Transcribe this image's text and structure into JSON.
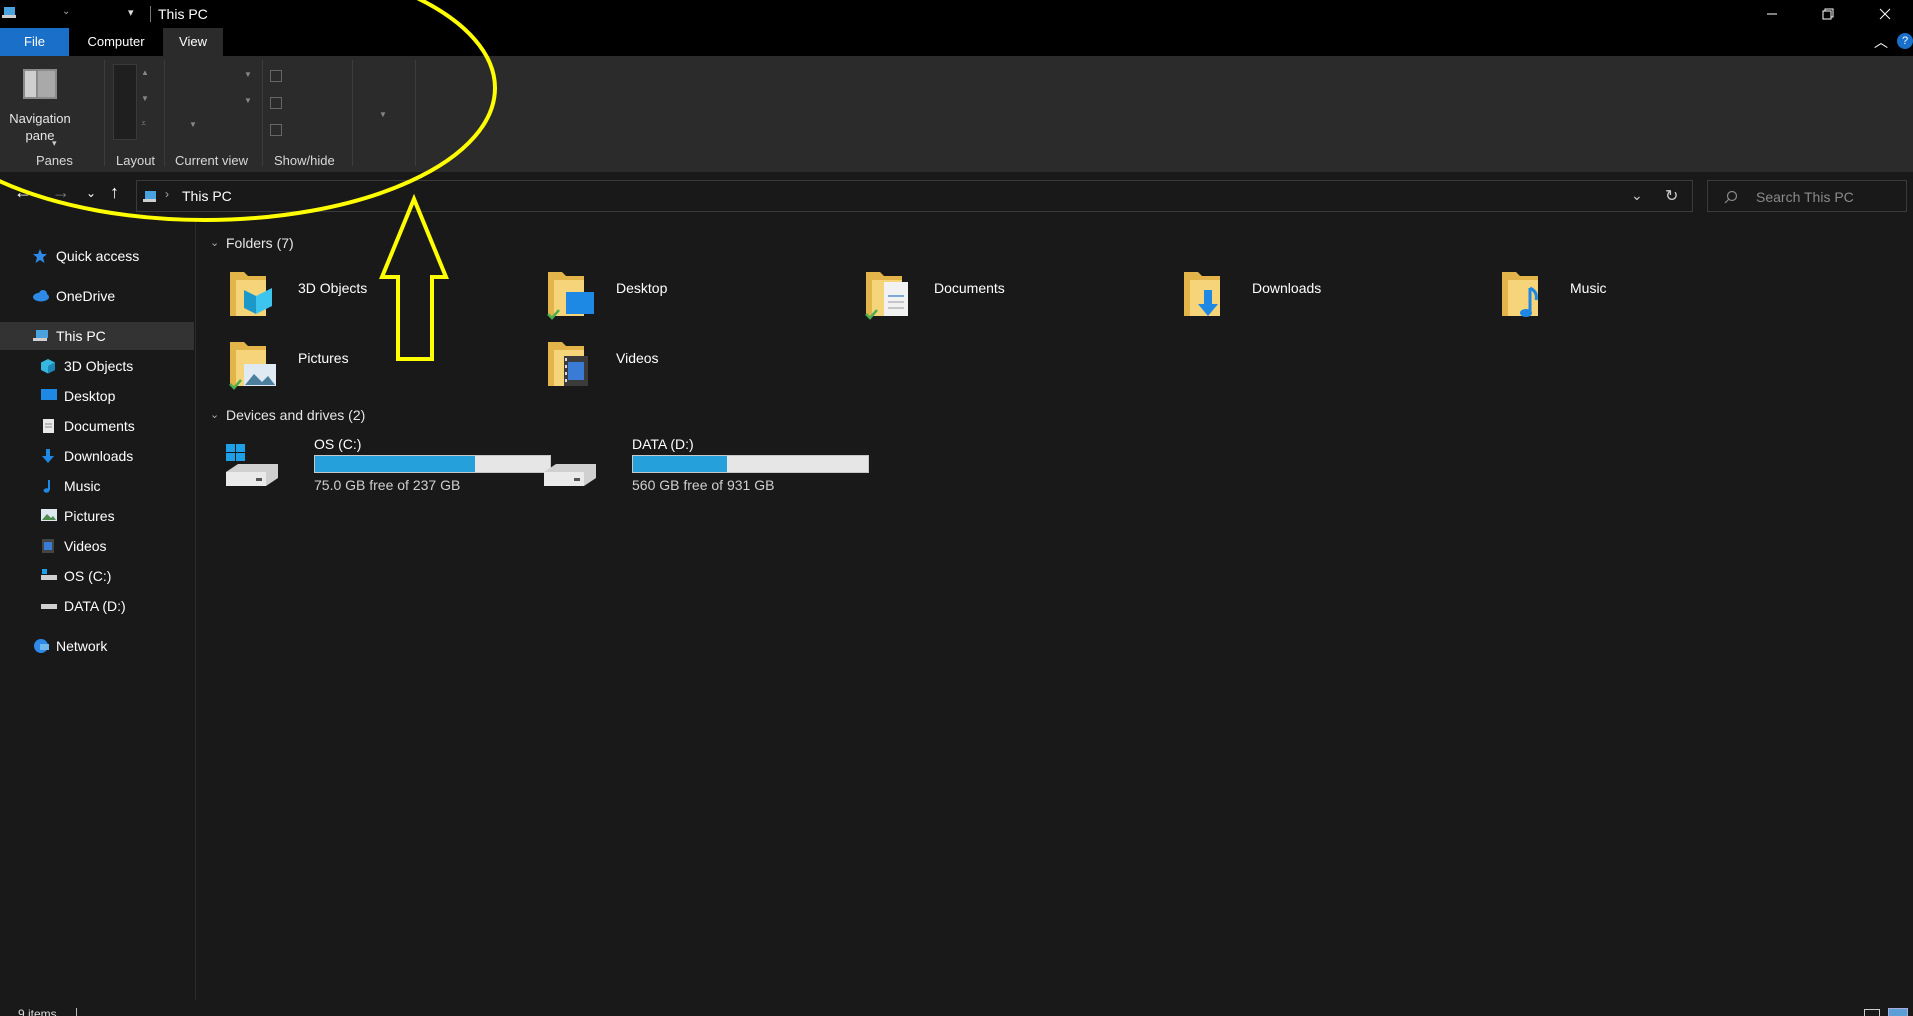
{
  "window": {
    "title": "This PC",
    "minimize_icon": "minimize-icon",
    "maximize_icon": "restore-icon",
    "close_icon": "close-icon"
  },
  "ribbon": {
    "tabs": [
      {
        "label": "File"
      },
      {
        "label": "Computer"
      },
      {
        "label": "View"
      }
    ],
    "navigation_pane_label": "Navigation pane",
    "groups": {
      "panes": "Panes",
      "layout": "Layout",
      "current_view": "Current view",
      "show_hide": "Show/hide"
    }
  },
  "address": {
    "path": "This PC",
    "search_placeholder": "Search This PC"
  },
  "sidebar": {
    "items": [
      {
        "label": "Quick access",
        "icon": "star-icon"
      },
      {
        "label": "OneDrive",
        "icon": "cloud-icon"
      },
      {
        "label": "This PC",
        "icon": "computer-icon"
      },
      {
        "label": "3D Objects",
        "icon": "cube-icon"
      },
      {
        "label": "Desktop",
        "icon": "desktop-icon"
      },
      {
        "label": "Documents",
        "icon": "document-icon"
      },
      {
        "label": "Downloads",
        "icon": "download-icon"
      },
      {
        "label": "Music",
        "icon": "music-icon"
      },
      {
        "label": "Pictures",
        "icon": "picture-icon"
      },
      {
        "label": "Videos",
        "icon": "video-icon"
      },
      {
        "label": "OS (C:)",
        "icon": "drive-icon"
      },
      {
        "label": "DATA (D:)",
        "icon": "drive-icon"
      },
      {
        "label": "Network",
        "icon": "network-icon"
      }
    ]
  },
  "content": {
    "folders_header": "Folders (7)",
    "folders": [
      {
        "label": "3D Objects"
      },
      {
        "label": "Desktop"
      },
      {
        "label": "Documents"
      },
      {
        "label": "Downloads"
      },
      {
        "label": "Music"
      },
      {
        "label": "Pictures"
      },
      {
        "label": "Videos"
      }
    ],
    "drives_header": "Devices and drives (2)",
    "drives": [
      {
        "name": "OS (C:)",
        "free": "75.0 GB free of 237 GB",
        "used_fraction": 0.68
      },
      {
        "name": "DATA (D:)",
        "free": "560 GB free of 931 GB",
        "used_fraction": 0.4
      }
    ]
  },
  "status": {
    "items": "9 items"
  },
  "colors": {
    "accent": "#1a6fc9",
    "drive_bar": "#26a0da",
    "annotation": "#ffff00"
  }
}
